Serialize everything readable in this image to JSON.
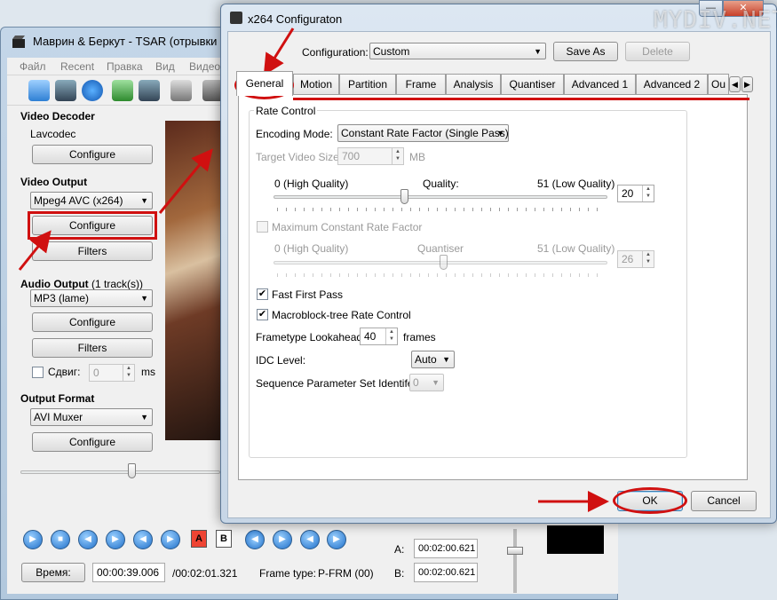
{
  "background_window": {
    "title": "Маврин & Беркут - TSAR (отрывки кон",
    "menu": [
      "Файл",
      "Recent",
      "Правка",
      "Вид",
      "Видео"
    ],
    "video_decoder": {
      "label": "Video Decoder",
      "codec": "Lavcodec",
      "configure": "Configure"
    },
    "video_output": {
      "label": "Video Output",
      "selected": "Mpeg4 AVC (x264)",
      "configure": "Configure",
      "filters": "Filters"
    },
    "audio_output": {
      "label": "Audio Output",
      "tracks": "(1 track(s))",
      "selected": "MP3 (lame)",
      "configure": "Configure",
      "filters": "Filters",
      "shift_label": "Сдвиг:",
      "shift_value": "0",
      "shift_unit": "ms"
    },
    "output_format": {
      "label": "Output Format",
      "selected": "AVI Muxer",
      "configure": "Configure"
    },
    "status": {
      "time_button": "Время:",
      "time_value": "00:00:39.006",
      "duration": "/00:02:01.321",
      "frame_type_label": "Frame type:",
      "frame_type_value": "P-FRM (00)",
      "a_label": "A:",
      "a_value": "00:02:00.621",
      "b_label": "B:",
      "b_value": "00:02:00.621"
    },
    "ab_buttons": {
      "a": "A",
      "b": "B"
    }
  },
  "dialog": {
    "title": "x264 Configuraton",
    "configuration_label": "Configuration:",
    "configuration_value": "Custom",
    "save_as": "Save As",
    "delete": "Delete",
    "tabs": [
      "General",
      "Motion",
      "Partition",
      "Frame",
      "Analysis",
      "Quantiser",
      "Advanced 1",
      "Advanced 2",
      "Ou"
    ],
    "rate_control": {
      "group_title": "Rate Control",
      "encoding_mode_label": "Encoding Mode:",
      "encoding_mode_value": "Constant Rate Factor (Single Pass)",
      "target_size_label": "Target Video Size:",
      "target_size_value": "700",
      "target_size_unit": "MB",
      "quality_low_label": "0 (High Quality)",
      "quality_mid_label": "Quality:",
      "quality_high_label": "51 (Low Quality)",
      "quality_value": "20",
      "quality_fraction": 0.39,
      "max_crf_label": "Maximum Constant Rate Factor",
      "quantiser_low_label": "0 (High Quality)",
      "quantiser_mid_label": "Quantiser",
      "quantiser_high_label": "51 (Low Quality)",
      "quantiser_value": "26",
      "quantiser_fraction": 0.51,
      "fast_first_pass": "Fast First Pass",
      "fast_first_pass_checked": true,
      "mb_tree": "Macroblock-tree Rate Control",
      "mb_tree_checked": true,
      "lookahead_label": "Frametype Lookahead:",
      "lookahead_value": "40",
      "lookahead_unit": "frames",
      "idc_label": "IDC Level:",
      "idc_value": "Auto",
      "sps_label": "Sequence Parameter Set Identifer:",
      "sps_value": "0"
    },
    "ok": "OK",
    "cancel": "Cancel"
  },
  "watermark": "MYDIV.NET",
  "colors": {
    "annotation_red": "#d01010",
    "selection_blue": "#3399ff"
  }
}
